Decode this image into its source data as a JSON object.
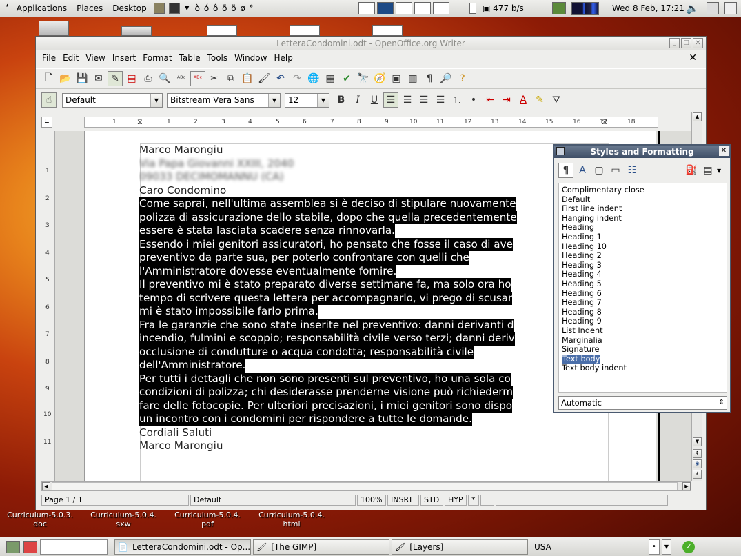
{
  "top_panel": {
    "menus": [
      "Applications",
      "Places",
      "Desktop"
    ],
    "keyboard_chars": "ò ó ô õ ö ø °",
    "network_rate": "477 b/s",
    "clock": "Wed  8 Feb, 17:21"
  },
  "desktop_icons": [
    {
      "label": "Curriculum-5.0.3.\ndoc"
    },
    {
      "label": "Curriculum-5.0.4.\nsxw"
    },
    {
      "label": "Curriculum-5.0.4.\npdf"
    },
    {
      "label": "Curriculum-5.0.4.\nhtml"
    }
  ],
  "window": {
    "title": "LetteraCondomini.odt - OpenOffice.org Writer",
    "menu": [
      "File",
      "Edit",
      "View",
      "Insert",
      "Format",
      "Table",
      "Tools",
      "Window",
      "Help"
    ],
    "formatting": {
      "paragraph_style": "Default",
      "font_name": "Bitstream Vera Sans",
      "font_size": "12"
    },
    "ruler_labels": [
      "1",
      "1",
      "2",
      "3",
      "4",
      "5",
      "6",
      "7",
      "8",
      "9",
      "10",
      "11",
      "12",
      "13",
      "14",
      "15",
      "16",
      "17",
      "18"
    ],
    "vruler_labels": [
      "1",
      "2",
      "3",
      "4",
      "5",
      "6",
      "7",
      "8",
      "9",
      "10",
      "11"
    ],
    "document": {
      "lines": [
        {
          "text": "Marco Marongiu",
          "style": "normal"
        },
        {
          "text": "Via Papa Giovanni XXIII, 2040",
          "style": "blurred"
        },
        {
          "text": "09033 DECIMOMANNU (CA)",
          "style": "blurred"
        },
        {
          "text": "Caro Condomino",
          "style": "normal"
        },
        {
          "text": "Come saprai, nell'ultima assemblea si è deciso di stipulare nuovamente",
          "style": "selected"
        },
        {
          "text": "polizza di assicurazione dello stabile, dopo che quella precedentemente",
          "style": "selected"
        },
        {
          "text": "essere è stata lasciata scadere senza rinnovarla.",
          "style": "selected"
        },
        {
          "text": "Essendo i miei genitori assicuratori, ho pensato che fosse il caso di ave",
          "style": "selected"
        },
        {
          "text": "preventivo da parte sua, per poterlo confrontare con quelli  che",
          "style": "selected"
        },
        {
          "text": "l'Amministratore dovesse eventualmente fornire.",
          "style": "selected"
        },
        {
          "text": "Il preventivo mi è stato preparato diverse settimane fa, ma solo ora ho",
          "style": "selected"
        },
        {
          "text": "tempo di scrivere questa lettera per accompagnarlo, vi prego di scusar",
          "style": "selected"
        },
        {
          "text": "mi è stato impossibile farlo prima.",
          "style": "selected"
        },
        {
          "text": "Fra le garanzie che sono state inserite nel preventivo: danni derivanti d",
          "style": "selected"
        },
        {
          "text": "incendio, fulmini e scoppio; responsabilità civile verso terzi; danni deriv",
          "style": "selected"
        },
        {
          "text": "occlusione di condutture o acqua condotta; responsabilità civile",
          "style": "selected"
        },
        {
          "text": "dell'Amministratore.",
          "style": "selected"
        },
        {
          "text": "Per tutti i dettagli che non sono presenti sul preventivo, ho una sola co",
          "style": "selected"
        },
        {
          "text": "condizioni di polizza; chi desiderasse prenderne visione può richiederm",
          "style": "selected"
        },
        {
          "text": "fare delle fotocopie. Per ulteriori precisazioni, i miei genitori sono dispo",
          "style": "selected"
        },
        {
          "text": "un incontro con i condomini per rispondere a tutte le domande.",
          "style": "selected"
        },
        {
          "text": "Cordiali Saluti",
          "style": "normal"
        },
        {
          "text": "Marco Marongiu",
          "style": "normal"
        }
      ]
    },
    "status": {
      "page": "Page 1 / 1",
      "style": "Default",
      "zoom": "100%",
      "insert_mode": "INSRT",
      "selection_mode": "STD",
      "hyphenation": "HYP",
      "modified": "*"
    }
  },
  "styles_panel": {
    "title": "Styles and Formatting",
    "items": [
      "Complimentary close",
      "Default",
      "First line indent",
      "Hanging indent",
      "Heading",
      "Heading 1",
      "Heading 10",
      "Heading 2",
      "Heading 3",
      "Heading 4",
      "Heading 5",
      "Heading 6",
      "Heading 7",
      "Heading 8",
      "Heading 9",
      "List Indent",
      "Marginalia",
      "Signature",
      "Text body",
      "Text body indent"
    ],
    "selected": "Text body",
    "filter": "Automatic"
  },
  "taskbar": {
    "tasks": [
      "LetteraCondomini.odt - Op...",
      "[The GIMP]",
      "[Layers]"
    ],
    "keyboard_layout": "USA"
  }
}
